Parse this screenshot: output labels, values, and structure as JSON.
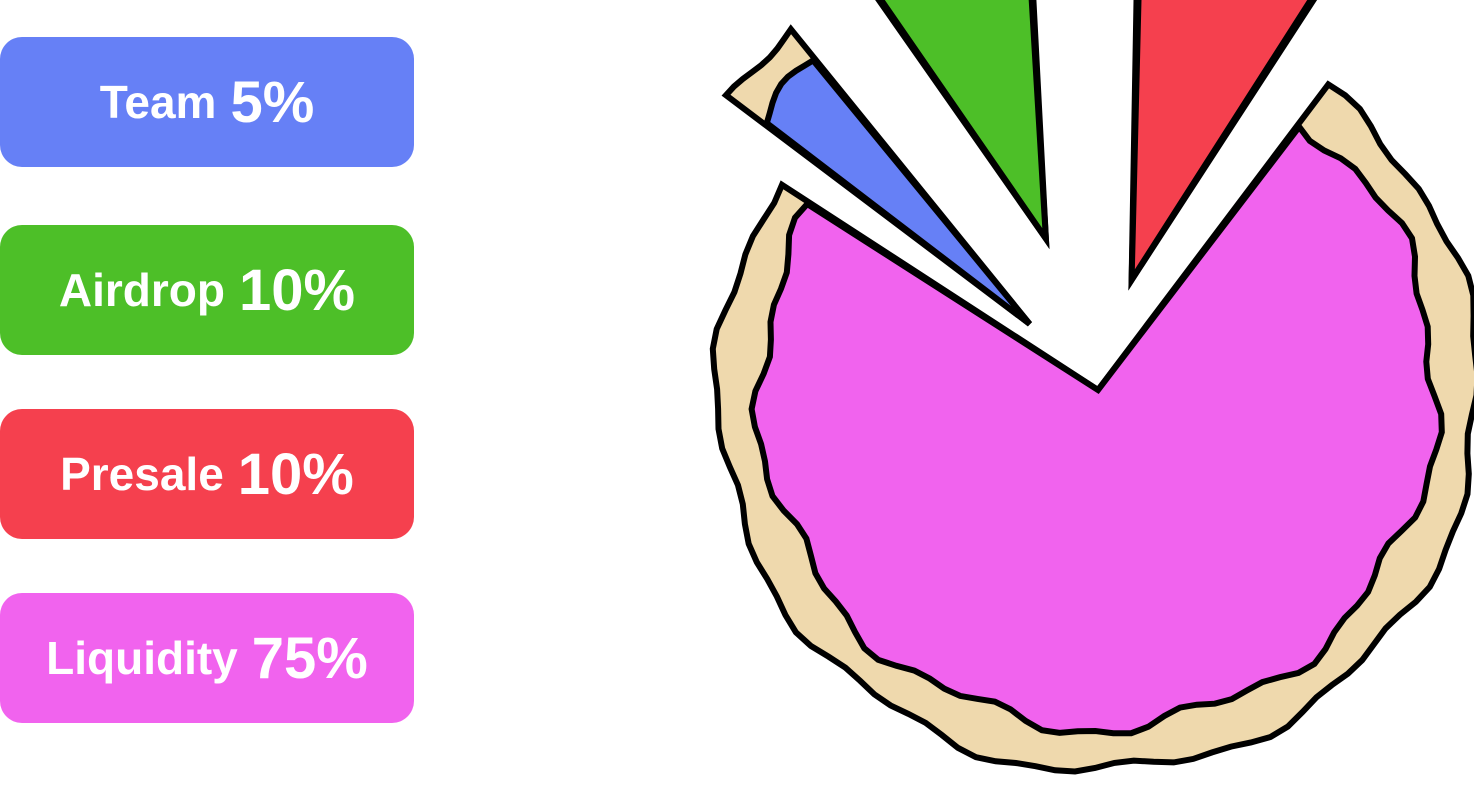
{
  "chart_data": {
    "type": "pie",
    "title": "",
    "categories": [
      "Team",
      "Airdrop",
      "Presale",
      "Liquidity"
    ],
    "labels": [
      "Team",
      "Airdrop",
      "Presale",
      "Liquidity"
    ],
    "value_labels": [
      "5%",
      "10%",
      "10%",
      "75%"
    ],
    "values": [
      5,
      10,
      10,
      75
    ],
    "unit": "%",
    "colors": [
      "#6680f6",
      "#4dbf28",
      "#f5404e",
      "#f163ee"
    ],
    "crust_color": "#efd9ad",
    "outline_color": "#000000",
    "legend": "left"
  }
}
